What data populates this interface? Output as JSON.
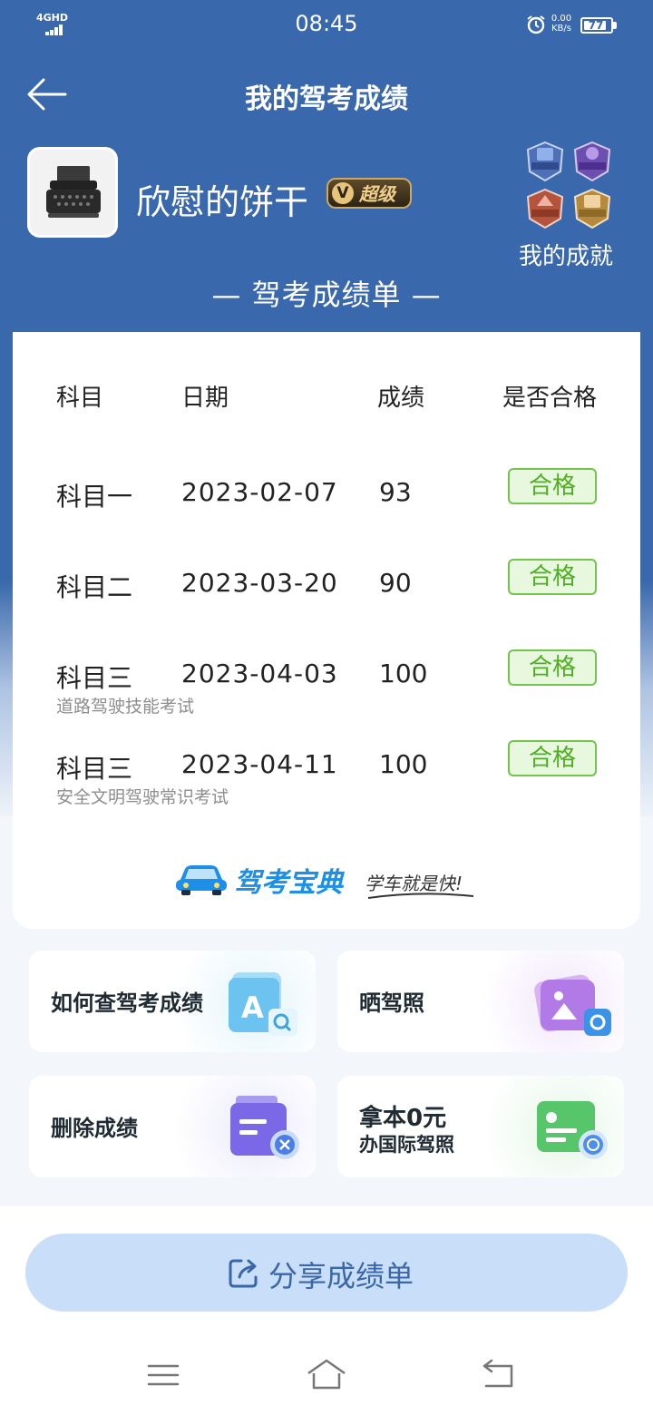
{
  "status_bar": {
    "network": "4GHD",
    "time": "08:45",
    "speed_value": "0.00",
    "speed_unit": "KB/s",
    "battery": "77"
  },
  "header": {
    "title": "我的驾考成绩"
  },
  "profile": {
    "username": "欣慰的饼干",
    "vip_letter": "V",
    "vip_label": "超级",
    "achievements_label": "我的成就"
  },
  "sheet": {
    "title": "— 驾考成绩单 —",
    "columns": [
      "科目",
      "日期",
      "成绩",
      "是否合格"
    ],
    "rows": [
      {
        "subject": "科目一",
        "date": "2023-02-07",
        "score": "93",
        "status": "合格",
        "note": ""
      },
      {
        "subject": "科目二",
        "date": "2023-03-20",
        "score": "90",
        "status": "合格",
        "note": ""
      },
      {
        "subject": "科目三",
        "date": "2023-04-03",
        "score": "100",
        "status": "合格",
        "note": "道路驾驶技能考试"
      },
      {
        "subject": "科目三",
        "date": "2023-04-11",
        "score": "100",
        "status": "合格",
        "note": "安全文明驾驶常识考试"
      }
    ],
    "brand_name": "驾考宝典",
    "brand_slogan": "学车就是快!"
  },
  "tiles": {
    "how_to_check": "如何查驾考成绩",
    "show_license": "晒驾照",
    "delete_scores": "删除成绩",
    "intl_license_line1": "拿本0元",
    "intl_license_line2": "办国际驾照"
  },
  "share": {
    "label": "分享成绩单"
  },
  "colors": {
    "header_blue": "#3a68ac",
    "pass_green": "#4fae22",
    "share_bg": "#c9def8",
    "brand_blue": "#1e8fe6"
  },
  "icons": {
    "back": "arrow-left-icon",
    "share": "share-icon",
    "nav_menu": "menu-icon",
    "nav_home": "home-icon",
    "nav_back": "return-icon"
  }
}
